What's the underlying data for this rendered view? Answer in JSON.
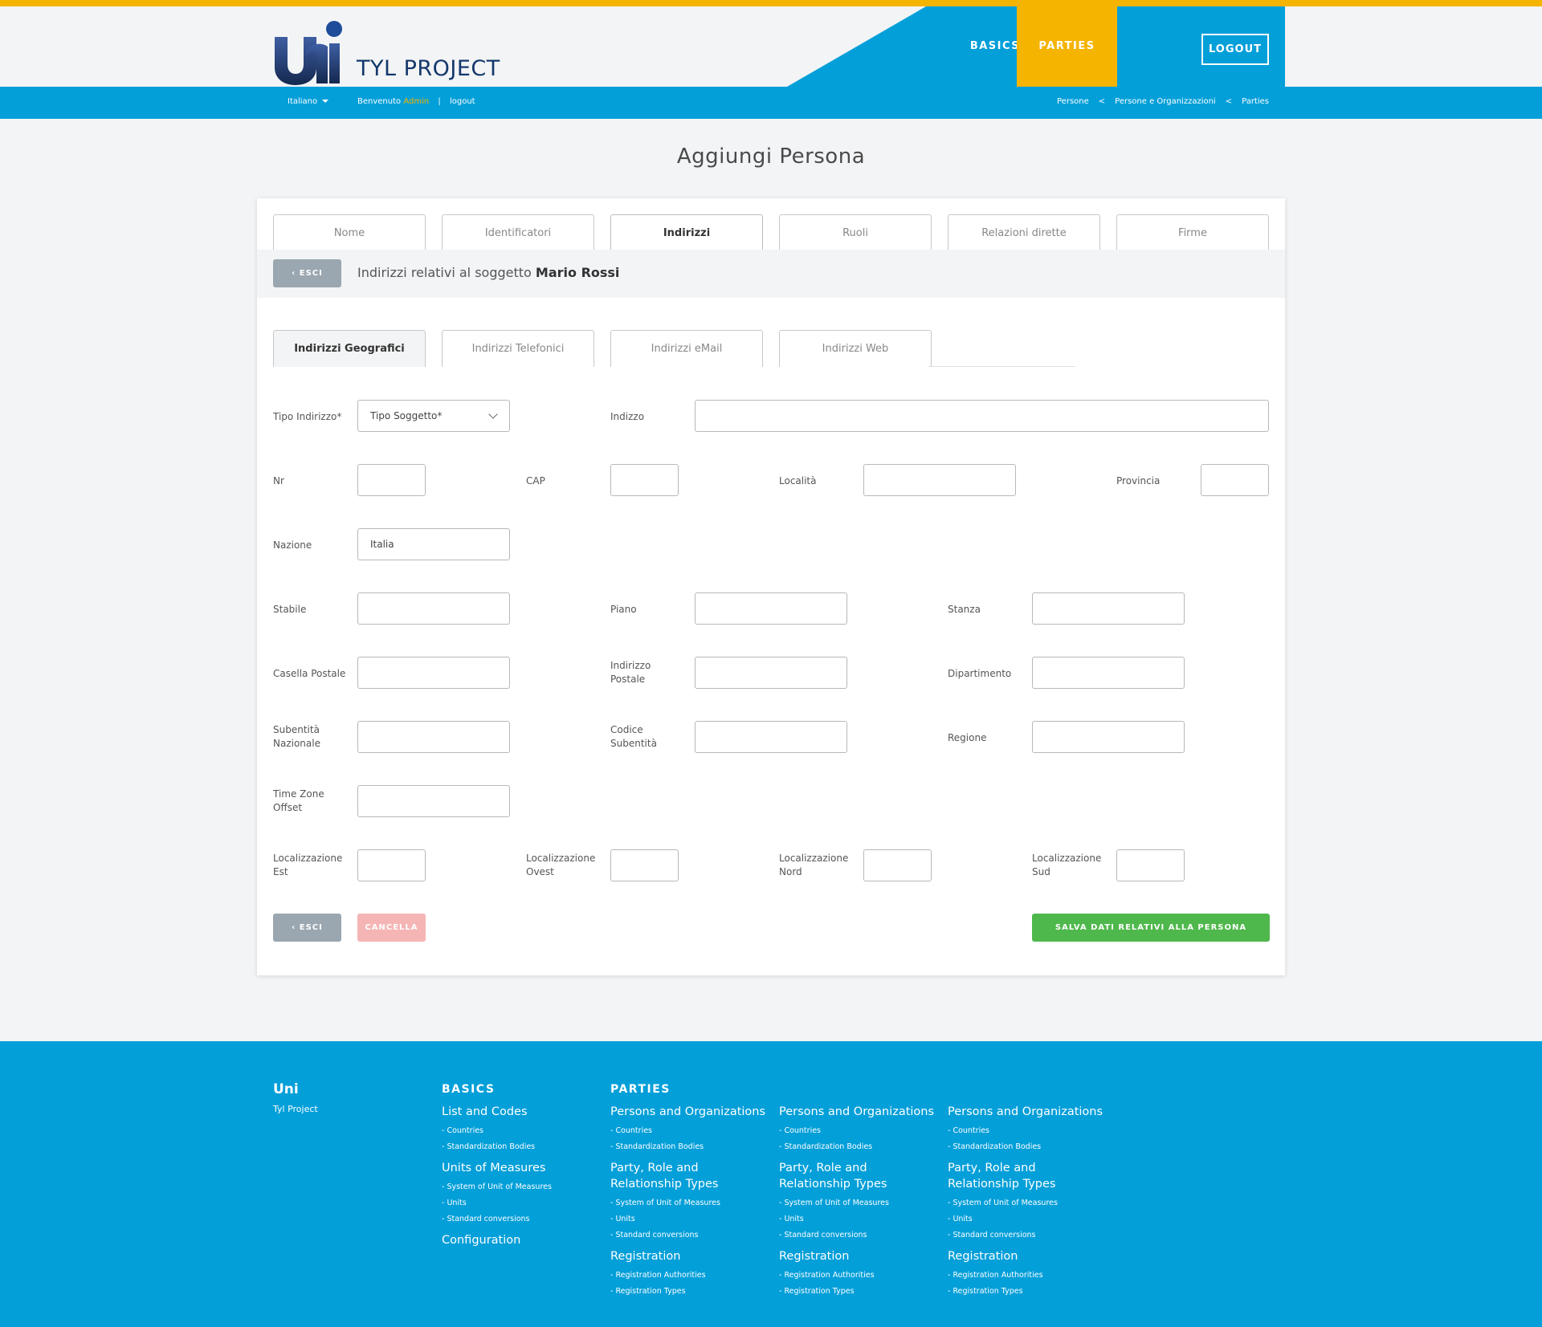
{
  "brand": {
    "logo_text": "Uni",
    "name": "TYL PROJECT"
  },
  "nav": {
    "basics": "BASICS",
    "parties": "PARTIES",
    "logout": "LOGOUT"
  },
  "colors": {
    "accent": "#f5b400",
    "primary": "#039fd9",
    "success": "#4fb84c",
    "danger_light": "#f5b5b5",
    "muted": "#9aa7b0"
  },
  "subbar": {
    "language": "Italiano",
    "welcome_prefix": "Benvenuto",
    "user": "Admin",
    "separator": "|",
    "logout_link": "logout",
    "breadcrumb": [
      "Persone",
      "Persone e Organizzazioni",
      "Parties"
    ],
    "breadcrumb_sep": "<"
  },
  "page_title": "Aggiungi Persona",
  "tabs": [
    {
      "label": "Nome"
    },
    {
      "label": "Identificatori"
    },
    {
      "label": "Indirizzi",
      "active": true
    },
    {
      "label": "Ruoli"
    },
    {
      "label": "Relazioni dirette"
    },
    {
      "label": "Firme"
    }
  ],
  "subject": {
    "exit_label": "ESCI",
    "text": "Indirizzi relativi al soggetto",
    "name": "Mario Rossi"
  },
  "subtabs": [
    {
      "label": "Indirizzi Geografici",
      "active": true
    },
    {
      "label": "Indirizzi Telefonici"
    },
    {
      "label": "Indirizzi eMail"
    },
    {
      "label": "Indirizzi Web"
    }
  ],
  "form": {
    "tipo_indirizzo": {
      "label": "Tipo Indirizzo*",
      "value": "Tipo Soggetto*"
    },
    "indirizzo": {
      "label": "Indizzo",
      "value": ""
    },
    "nr": {
      "label": "Nr",
      "value": ""
    },
    "cap": {
      "label": "CAP",
      "value": ""
    },
    "localita": {
      "label": "Località",
      "value": ""
    },
    "provincia": {
      "label": "Provincia",
      "value": ""
    },
    "nazione": {
      "label": "Nazione",
      "value": "Italia"
    },
    "stabile": {
      "label": "Stabile",
      "value": ""
    },
    "piano": {
      "label": "Piano",
      "value": ""
    },
    "stanza": {
      "label": "Stanza",
      "value": ""
    },
    "casella_postale": {
      "label": "Casella Postale",
      "value": ""
    },
    "indirizzo_postale": {
      "label_1": "Indirizzo",
      "label_2": "Postale",
      "value": ""
    },
    "dipartimento": {
      "label": "Dipartimento",
      "value": ""
    },
    "subentita_nazionale": {
      "label_1": "Subentità",
      "label_2": "Nazionale",
      "value": ""
    },
    "codice_subentita": {
      "label_1": "Codice",
      "label_2": "Subentità",
      "value": ""
    },
    "regione": {
      "label": "Regione",
      "value": ""
    },
    "time_zone": {
      "label_1": "Time Zone",
      "label_2": "Offset",
      "value": ""
    },
    "loc_est": {
      "label_1": "Localizzazione",
      "label_2": "Est",
      "value": ""
    },
    "loc_ovest": {
      "label_1": "Localizzazione",
      "label_2": "Ovest",
      "value": ""
    },
    "loc_nord": {
      "label_1": "Localizzazione",
      "label_2": "Nord",
      "value": ""
    },
    "loc_sud": {
      "label_1": "Localizzazione",
      "label_2": "Sud",
      "value": ""
    }
  },
  "actions": {
    "exit": "ESCI",
    "cancel": "CANCELLA",
    "save": "SALVA DATI RELATIVI ALLA PERSONA"
  },
  "footer": {
    "brand": "Uni",
    "brand_sub": "Tyl Project",
    "basics": {
      "head": "BASICS",
      "groups": [
        {
          "title": "List and Codes",
          "links": [
            "- Countries",
            "- Standardization Bodies"
          ]
        },
        {
          "title": "Units of Measures",
          "links": [
            "- System of Unit of Measures",
            "- Units",
            "- Standard conversions"
          ]
        },
        {
          "title": "Configuration",
          "links": []
        }
      ]
    },
    "parties_head": "PARTIES",
    "parties_cols": [
      {
        "groups": [
          {
            "title": "Persons and Organizations",
            "links": [
              "- Countries",
              "- Standardization Bodies"
            ]
          },
          {
            "title": "Party, Role and Relationship Types",
            "links": [
              "- System of Unit of Measures",
              "- Units",
              "- Standard conversions"
            ]
          },
          {
            "title": "Registration",
            "links": [
              "- Registration Authorities",
              "- Registration Types"
            ]
          }
        ]
      },
      {
        "groups": [
          {
            "title": "Persons and Organizations",
            "links": [
              "- Countries",
              "- Standardization Bodies"
            ]
          },
          {
            "title": "Party, Role and Relationship Types",
            "links": [
              "- System of Unit of Measures",
              "- Units",
              "- Standard conversions"
            ]
          },
          {
            "title": "Registration",
            "links": [
              "- Registration Authorities",
              "- Registration Types"
            ]
          }
        ]
      },
      {
        "groups": [
          {
            "title": "Persons and Organizations",
            "links": [
              "- Countries",
              "- Standardization Bodies"
            ]
          },
          {
            "title": "Party, Role and Relationship Types",
            "links": [
              "- System of Unit of Measures",
              "- Units",
              "- Standard conversions"
            ]
          },
          {
            "title": "Registration",
            "links": [
              "- Registration Authorities",
              "- Registration Types"
            ]
          }
        ]
      }
    ]
  }
}
